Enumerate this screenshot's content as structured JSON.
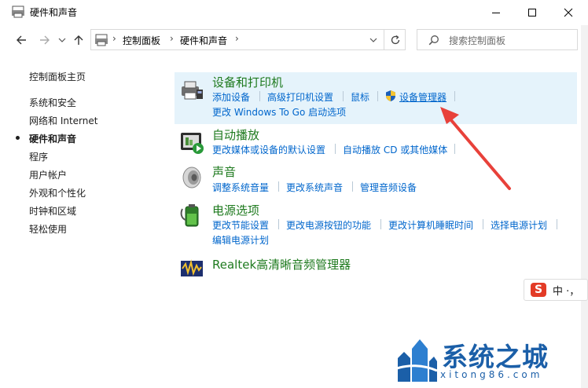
{
  "window": {
    "title": "硬件和声音",
    "controls": {
      "minimize": "minimize-icon",
      "maximize": "maximize-icon",
      "close": "close-icon"
    }
  },
  "navigation": {
    "back_icon": "arrow-left-icon",
    "forward_icon": "arrow-right-icon",
    "dropdown_icon": "chevron-down-icon",
    "up_icon": "arrow-up-icon",
    "breadcrumbs": [
      "控制面板",
      "硬件和声音"
    ],
    "refresh_icon": "refresh-icon",
    "search_placeholder": "搜索控制面板"
  },
  "sidebar": {
    "items": [
      {
        "label": "控制面板主页",
        "current": false
      },
      {
        "label": "系统和安全",
        "current": false
      },
      {
        "label": "网络和 Internet",
        "current": false
      },
      {
        "label": "硬件和声音",
        "current": true
      },
      {
        "label": "程序",
        "current": false
      },
      {
        "label": "用户帐户",
        "current": false
      },
      {
        "label": "外观和个性化",
        "current": false
      },
      {
        "label": "时钟和区域",
        "current": false
      },
      {
        "label": "轻松使用",
        "current": false
      }
    ]
  },
  "categories": [
    {
      "title": "设备和打印机",
      "icon": "printer-device-icon",
      "links": [
        "添加设备",
        "高级打印机设置",
        "鼠标",
        "设备管理器",
        "更改 Windows To Go 启动选项"
      ]
    },
    {
      "title": "自动播放",
      "icon": "autoplay-icon",
      "links": [
        "更改媒体或设备的默认设置",
        "自动播放 CD 或其他媒体"
      ]
    },
    {
      "title": "声音",
      "icon": "speaker-icon",
      "links": [
        "调整系统音量",
        "更改系统声音",
        "管理音频设备"
      ]
    },
    {
      "title": "电源选项",
      "icon": "battery-icon",
      "links": [
        "更改节能设置",
        "更改电源按钮的功能",
        "更改计算机睡眠时间",
        "选择电源计划",
        "编辑电源计划"
      ]
    },
    {
      "title": "Realtek高清晰音频管理器",
      "icon": "realtek-audio-icon",
      "links": []
    }
  ],
  "ime": {
    "logo": "S",
    "text": "中 ·，"
  },
  "watermark": {
    "text": "系统之城",
    "url": "xitong86.com"
  },
  "colors": {
    "link": "#0066cc",
    "category_title": "#1e7a1e",
    "highlight": "#e5f3fb",
    "arrow": "#e8413a"
  }
}
